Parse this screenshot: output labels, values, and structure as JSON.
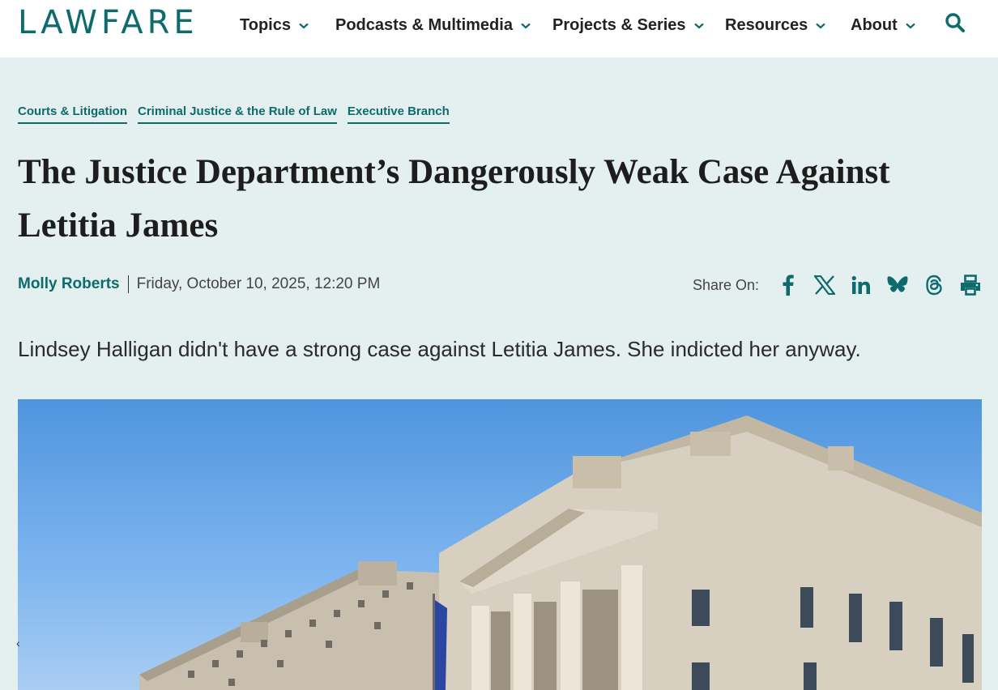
{
  "header": {
    "logo": "LAWFARE",
    "nav": [
      {
        "label": "Topics"
      },
      {
        "label": "Podcasts & Multimedia"
      },
      {
        "label": "Projects & Series"
      },
      {
        "label": "Resources"
      },
      {
        "label": "About"
      }
    ],
    "search_icon": "search-icon"
  },
  "article": {
    "tags": [
      {
        "label": "Courts & Litigation"
      },
      {
        "label": "Criminal Justice & the Rule of Law"
      },
      {
        "label": "Executive Branch"
      }
    ],
    "title": "The Justice Department’s Dangerously Weak Case Against Letitia James",
    "author": "Molly Roberts",
    "date": "Friday, October 10, 2025, 12:20 PM",
    "share_label": "Share On:",
    "share_icons": [
      "facebook-icon",
      "x-icon",
      "linkedin-icon",
      "bluesky-icon",
      "threads-icon",
      "print-icon"
    ],
    "dek": "Lindsey Halligan didn't have a strong case against Letitia James. She indicted her anyway.",
    "carousel_prev": "‹"
  },
  "colors": {
    "brand": "#0d6a6d",
    "background": "#e4efef",
    "header_bg": "#ffffff"
  }
}
